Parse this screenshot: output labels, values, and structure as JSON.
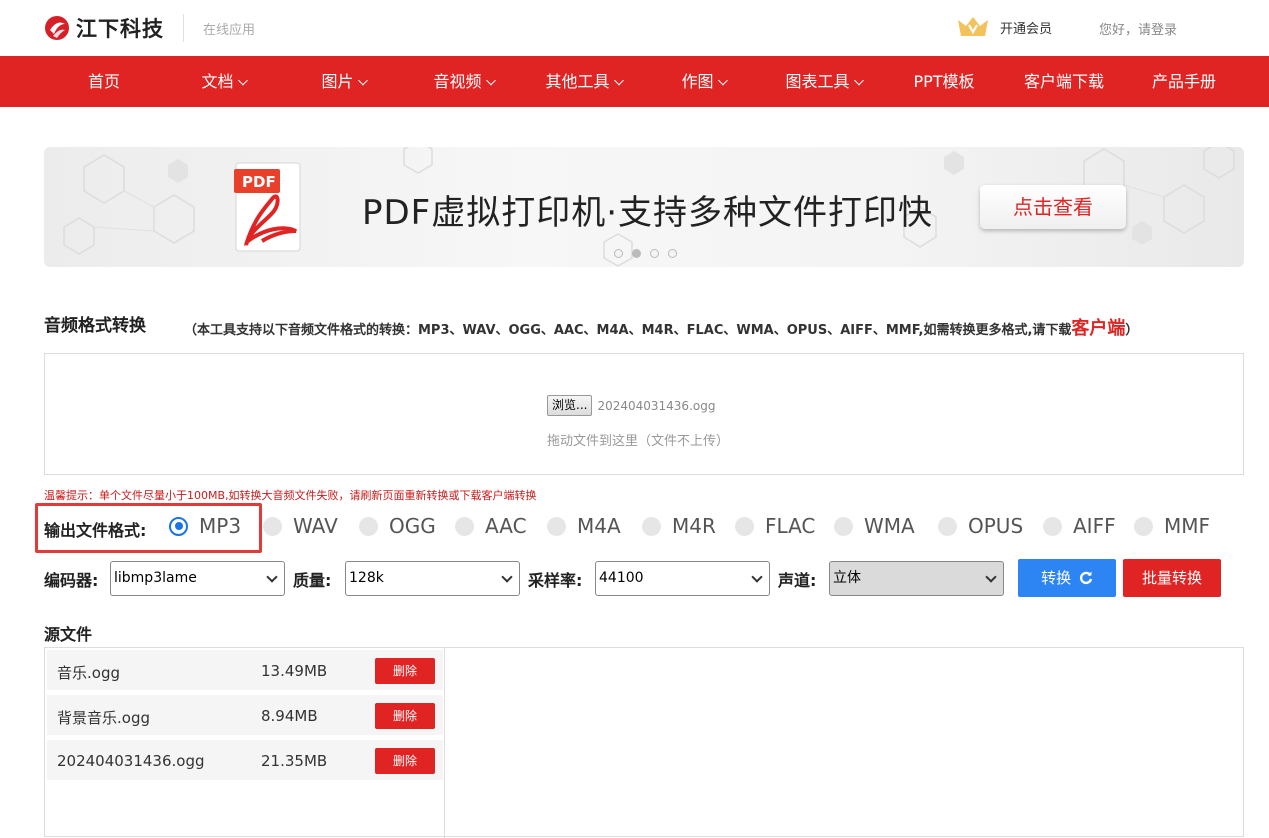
{
  "header": {
    "logo_text": "江下科技",
    "subtitle": "在线应用",
    "vip_label": "开通会员",
    "login_label": "您好，请登录"
  },
  "nav": {
    "items": [
      {
        "label": "首页",
        "dropdown": false
      },
      {
        "label": "文档",
        "dropdown": true
      },
      {
        "label": "图片",
        "dropdown": true
      },
      {
        "label": "音视频",
        "dropdown": true
      },
      {
        "label": "其他工具",
        "dropdown": true
      },
      {
        "label": "作图",
        "dropdown": true
      },
      {
        "label": "图表工具",
        "dropdown": true
      },
      {
        "label": "PPT模板",
        "dropdown": false
      },
      {
        "label": "客户端下载",
        "dropdown": false
      },
      {
        "label": "产品手册",
        "dropdown": false
      }
    ]
  },
  "banner": {
    "icon_label": "PDF",
    "headline": "PDF虚拟打印机·支持多种文件打印快",
    "button_label": "点击查看",
    "slide_count": 4,
    "active_slide": 2
  },
  "tool": {
    "title": "音频格式转换",
    "note_prefix": "（本工具支持以下音频文件格式的转换：MP3、WAV、OGG、AAC、M4A、M4R、FLAC、WMA、OPUS、AIFF、MMF,如需转换更多格式,请下载",
    "note_link": "客户端",
    "note_suffix": "）"
  },
  "upload": {
    "browse_label": "浏览...",
    "file_name": "202404031436.ogg",
    "drop_hint": "拖动文件到这里（文件不上传）"
  },
  "tip": "温馨提示：单个文件尽量小于100MB,如转换大音频文件失败，请刷新页面重新转换或下载客户端转换",
  "format": {
    "label": "输出文件格式:",
    "options": [
      "MP3",
      "WAV",
      "OGG",
      "AAC",
      "M4A",
      "M4R",
      "FLAC",
      "WMA",
      "OPUS",
      "AIFF",
      "MMF"
    ],
    "selected": "MP3"
  },
  "settings": {
    "encoder_label": "编码器:",
    "encoder_value": "libmp3lame",
    "quality_label": "质量:",
    "quality_value": "128k",
    "samplerate_label": "采样率:",
    "samplerate_value": "44100",
    "channel_label": "声道:",
    "channel_value": "立体",
    "convert_label": "转换",
    "batch_label": "批量转换"
  },
  "source": {
    "title": "源文件",
    "delete_label": "删除",
    "files": [
      {
        "name": "音乐.ogg",
        "size": "13.49MB"
      },
      {
        "name": "背景音乐.ogg",
        "size": "8.94MB"
      },
      {
        "name": "202404031436.ogg",
        "size": "21.35MB"
      }
    ]
  },
  "colors": {
    "brand_red": "#e02424",
    "accent_blue": "#2c85f2",
    "radio_blue": "#1a73e8"
  }
}
